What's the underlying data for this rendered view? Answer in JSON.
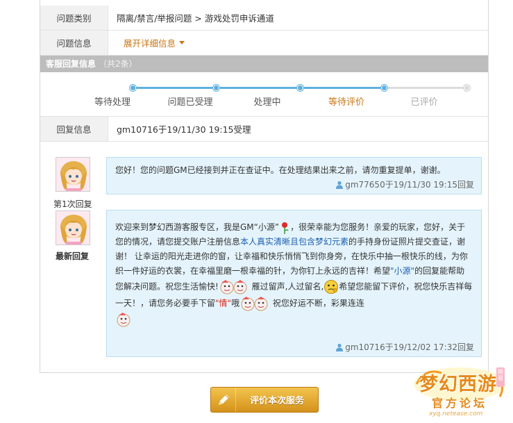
{
  "info": {
    "category_label": "问题类别",
    "category_value": "隔离/禁言/举报问题 > 游戏处罚申诉通道",
    "detail_label": "问题信息",
    "detail_link": "展开详细信息"
  },
  "section": {
    "title": "客服回复信息",
    "count": "（共2条）"
  },
  "progress": {
    "steps": [
      "等待处理",
      "问题已受理",
      "处理中",
      "等待评价",
      "已评价"
    ],
    "current_index": 3
  },
  "reply_info": {
    "label": "回复信息",
    "value": "gm10716于19/11/30 19:15受理"
  },
  "replies": [
    {
      "caption": "第1次回复",
      "text": "您好！您的问题GM已经接到并正在查证中。在处理结果出来之前，请勿重复提单，谢谢。",
      "meta": "gm77650于19/11/30 19:15回复"
    },
    {
      "caption": "最新回复",
      "p1": "欢迎来到梦幻西游客服专区，我是GM“小源”",
      "p2": "，很荣幸能为您服务！亲爱的玩家，您好，关于您的情况，请您提交账户注册信息",
      "p3_blue": "本人真实清晰且包含梦幻元素",
      "p4": "的手持身份证照片提交查证，谢谢！ 让幸运的阳光走进你的窗，让幸福和快乐悄悄飞到你身旁，在快乐中抽一根快乐的线，为你织一件好运的衣裳，在幸福里磨一根幸福的针，为你钉上永远的吉祥！希望",
      "p5_blue": "\"小源\"",
      "p6": "的回复能帮助您解决问题。祝您生活愉快!",
      "p7": " 雁过留声,人过留名,",
      "p8": "希望您能留下评价，祝您快乐吉祥每一天！，请您务必要手下留",
      "p9_red": "\"情\"",
      "p10": "哦",
      "p11": " 祝您好运不断，彩果连连",
      "meta": "gm10716于19/12/02 17:32回复"
    }
  ],
  "button": {
    "label": "评价本次服务"
  },
  "logo": {
    "text": "梦幻西游",
    "sub": "官方论坛",
    "url": "xyq.netease.com",
    "badge": "网易"
  },
  "colors": {
    "accent_blue": "#5fb0de",
    "current_step": "#c87512",
    "bubble_bg": "#e5f4fc",
    "button": "#e2a42e"
  }
}
